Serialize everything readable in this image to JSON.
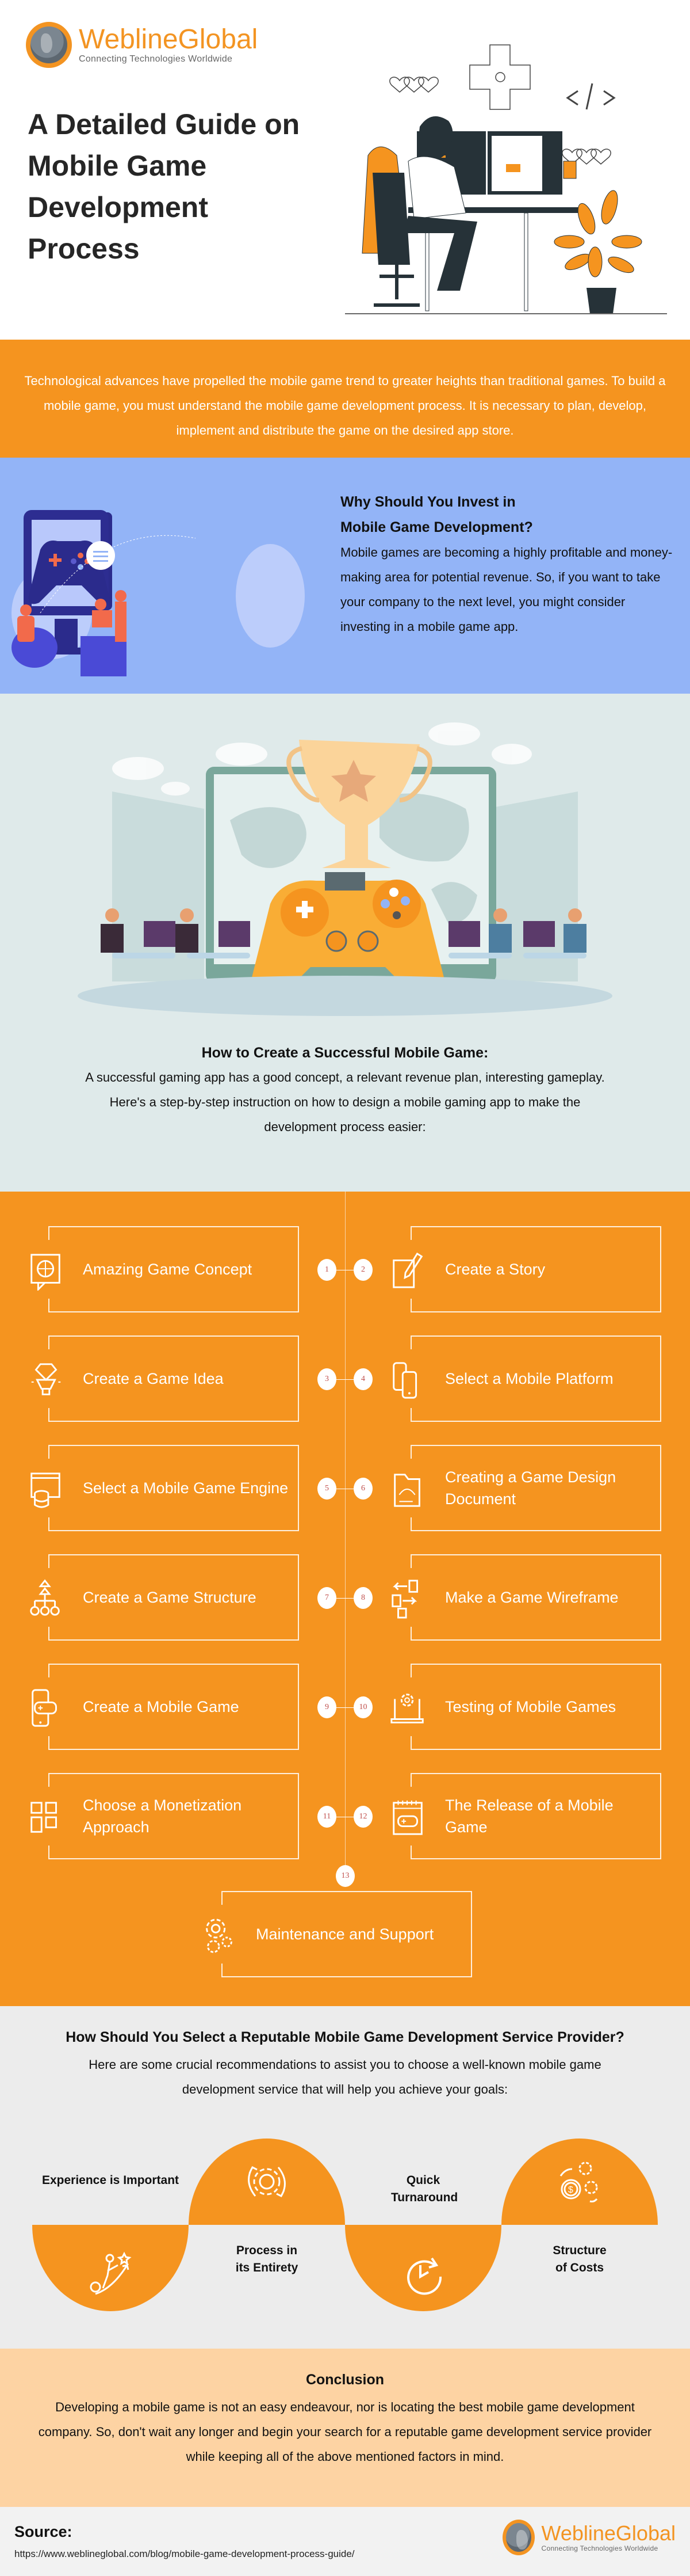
{
  "brand": {
    "name": "WeblineGlobal",
    "tagline": "Connecting Technologies Worldwide",
    "accent": "#f5941f"
  },
  "hero": {
    "title": "A Detailed Guide on Mobile Game Development Process",
    "illustration": "game-developer-at-desk"
  },
  "intro": {
    "text": "Technological advances have propelled the mobile game trend to greater heights than traditional games. To build a mobile game, you must understand the mobile game development process. It is necessary to plan, develop, implement and distribute the game on the desired app store."
  },
  "invest": {
    "heading_line1": "Why Should You Invest in",
    "heading_line2": "Mobile Game Development?",
    "body": "Mobile games are becoming a highly profitable and money-making area for potential revenue. So, if you want to take your company to the next level, you might consider investing in a mobile game app.",
    "illustration": "gamers-with-controller-monitor"
  },
  "create": {
    "heading": "How to Create a Successful Mobile Game:",
    "body": "A successful gaming app has a good concept, a relevant revenue plan, interesting gameplay. Here's a step-by-step instruction on how to design a mobile gaming app to make the development process easier:",
    "illustration": "esports-trophy-controller"
  },
  "steps": [
    {
      "num": "1",
      "label": "Amazing Game Concept",
      "icon": "globe-chat-icon"
    },
    {
      "num": "2",
      "label": "Create a Story",
      "icon": "pencil-paper-icon"
    },
    {
      "num": "3",
      "label": "Create a Game Idea",
      "icon": "diamond-bulb-icon"
    },
    {
      "num": "4",
      "label": "Select a Mobile Platform",
      "icon": "mobile-devices-icon"
    },
    {
      "num": "5",
      "label": "Select a Mobile Game Engine",
      "icon": "browser-database-icon"
    },
    {
      "num": "6",
      "label": "Creating a Game Design Document",
      "icon": "design-folder-icon"
    },
    {
      "num": "7",
      "label": "Create a Game Structure",
      "icon": "hierarchy-icon"
    },
    {
      "num": "8",
      "label": "Make a Game Wireframe",
      "icon": "wireframe-flow-icon"
    },
    {
      "num": "9",
      "label": "Create a Mobile Game",
      "icon": "phone-gamepad-icon"
    },
    {
      "num": "10",
      "label": "Testing of Mobile Games",
      "icon": "laptop-gear-icon"
    },
    {
      "num": "11",
      "label": "Choose a Monetization Approach",
      "icon": "app-grid-icon"
    },
    {
      "num": "12",
      "label": "The Release of a Mobile Game",
      "icon": "calendar-gamepad-icon"
    },
    {
      "num": "13",
      "label": "Maintenance and Support",
      "icon": "gears-icon"
    }
  ],
  "provider": {
    "heading": "How Should You Select a Reputable Mobile Game Development Service Provider?",
    "body": "Here are some crucial recommendations to assist you to choose a well-known mobile game development service that will help you achieve your goals:",
    "factors": [
      {
        "label": "Experience is Important",
        "icon": "climber-growth-icon"
      },
      {
        "label": "Process in its Entirety",
        "icon": "gear-cycle-icon"
      },
      {
        "label": "Quick Turnaround",
        "icon": "clock-refresh-icon"
      },
      {
        "label": "Structure of Costs",
        "icon": "dollar-gears-icon"
      }
    ]
  },
  "conclusion": {
    "heading": "Conclusion",
    "body": "Developing a mobile game is not an easy endeavour, nor is locating the best mobile game development company. So, don't wait any longer and begin your search for a reputable game development service provider while keeping all of the above mentioned factors in mind."
  },
  "footer": {
    "source_label": "Source:",
    "source_url": "https://www.weblineglobal.com/blog/mobile-game-development-process-guide/"
  }
}
